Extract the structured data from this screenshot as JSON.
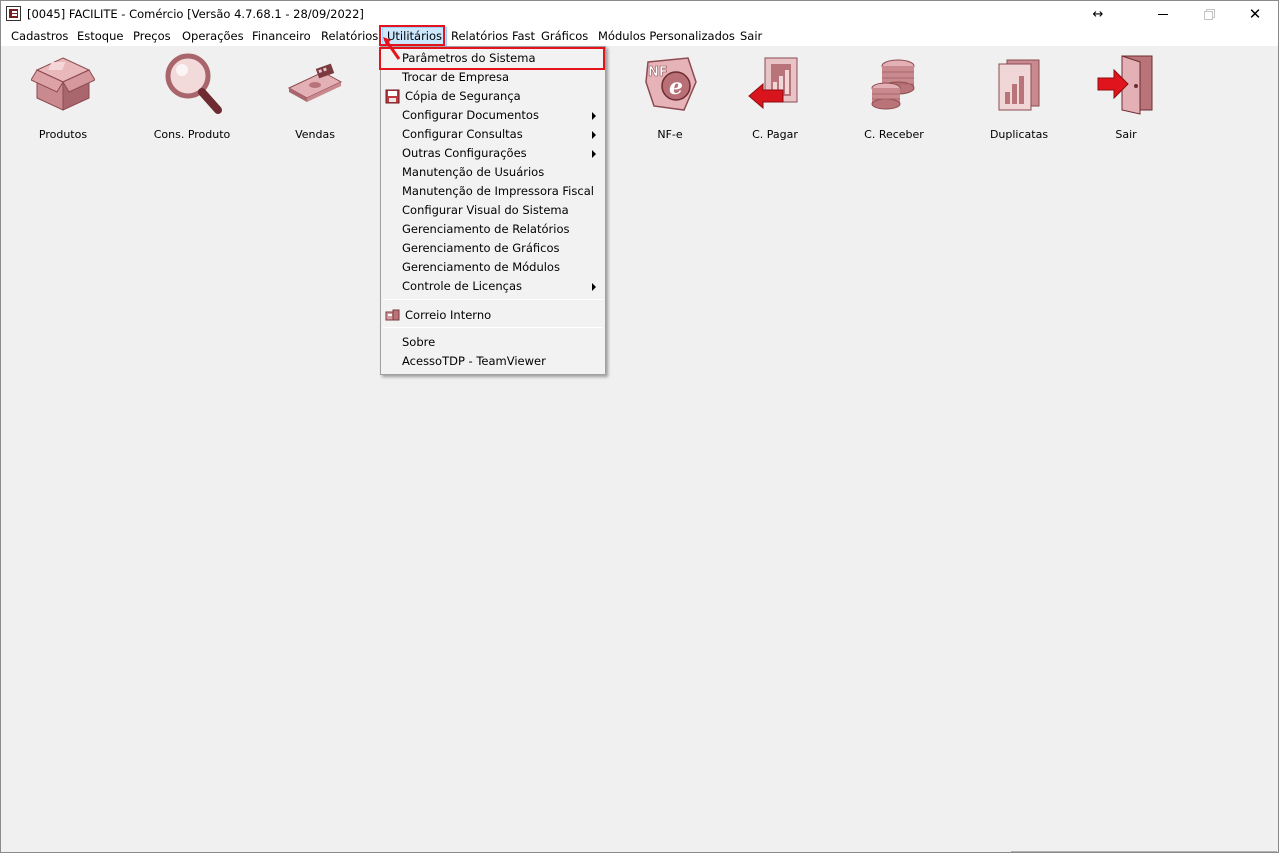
{
  "window": {
    "title": "[0045] FACILITE - Comércio [Versão 4.7.68.1 - 28/09/2022]",
    "resize_glyph": "↔",
    "close_glyph": "✕"
  },
  "menubar": {
    "items": [
      {
        "label": "Cadastros"
      },
      {
        "label": "Estoque"
      },
      {
        "label": "Preços"
      },
      {
        "label": "Operações"
      },
      {
        "label": "Financeiro"
      },
      {
        "label": "Relatórios"
      },
      {
        "label": "Utilitários"
      },
      {
        "label": "Relatórios Fast"
      },
      {
        "label": "Gráficos"
      },
      {
        "label": "Módulos Personalizados"
      },
      {
        "label": "Sair"
      }
    ]
  },
  "toolbar": {
    "buttons": [
      {
        "label": "Produtos",
        "icon": "box-icon"
      },
      {
        "label": "Cons. Produto",
        "icon": "magnifier-icon"
      },
      {
        "label": "Vendas",
        "icon": "money-icon"
      },
      {
        "label": "NF-e",
        "icon": "nfe-icon"
      },
      {
        "label": "C. Pagar",
        "icon": "payables-icon"
      },
      {
        "label": "C. Receber",
        "icon": "coins-icon"
      },
      {
        "label": "Duplicatas",
        "icon": "duplicates-icon"
      },
      {
        "label": "Sair",
        "icon": "exit-door-icon"
      }
    ]
  },
  "dropdown": {
    "items": [
      {
        "label": "Parâmetros do Sistema"
      },
      {
        "label": "Trocar de Empresa"
      },
      {
        "label": "Cópia de Segurança",
        "icon": "floppy-disk-icon"
      },
      {
        "label": "Configurar Documentos",
        "submenu": true
      },
      {
        "label": "Configurar Consultas",
        "submenu": true
      },
      {
        "label": "Outras Configurações",
        "submenu": true
      },
      {
        "label": "Manutenção de Usuários"
      },
      {
        "label": "Manutenção de Impressora Fiscal"
      },
      {
        "label": "Configurar Visual do Sistema"
      },
      {
        "label": "Gerenciamento de Relatórios"
      },
      {
        "label": "Gerenciamento de Gráficos"
      },
      {
        "label": "Gerenciamento de Módulos"
      },
      {
        "label": "Controle de Licenças",
        "submenu": true
      },
      {
        "label": "Correio Interno",
        "icon": "mailbox-icon"
      },
      {
        "label": "Sobre"
      },
      {
        "label": "AcessoTDP - TeamViewer"
      }
    ]
  },
  "colors": {
    "accent_red": "#e5141c",
    "icon_rose": "#c98a8f",
    "menu_active_bg": "#cce8ff"
  }
}
